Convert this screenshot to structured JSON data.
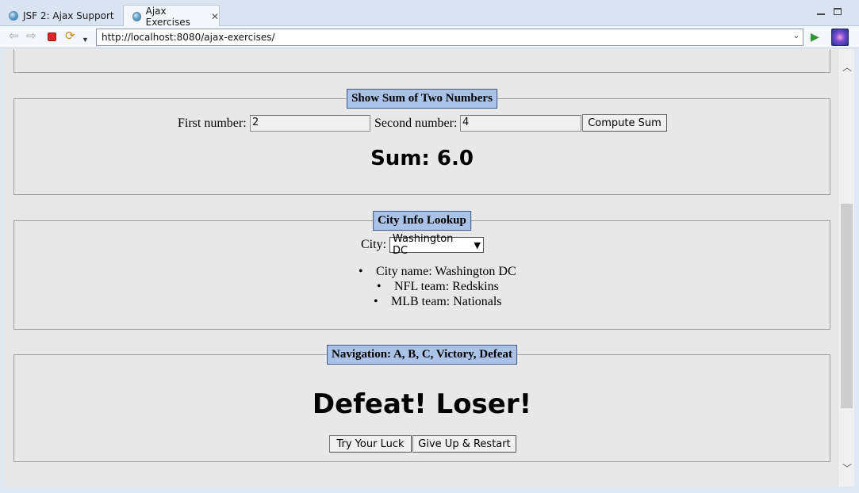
{
  "tabs": [
    {
      "label": "JSF 2: Ajax Support"
    },
    {
      "label": "Ajax Exercises"
    }
  ],
  "toolbar": {
    "url": "http://localhost:8080/ajax-exercises/"
  },
  "sum_section": {
    "legend": "Show Sum of Two Numbers",
    "first_label": "First number:",
    "first_value": "2",
    "second_label": "Second number:",
    "second_value": "4",
    "button_label": "Compute Sum",
    "result": "Sum: 6.0"
  },
  "city_section": {
    "legend": "City Info Lookup",
    "city_label": "City:",
    "selected_city": "Washington DC",
    "items": [
      "City name: Washington DC",
      "NFL team: Redskins",
      "MLB team: Nationals"
    ]
  },
  "nav_section": {
    "legend": "Navigation: A, B, C, Victory, Defeat",
    "heading": "Defeat! Loser!",
    "try_button": "Try Your Luck",
    "restart_button": "Give Up & Restart"
  },
  "icons": {
    "back": "back-arrow-icon",
    "forward": "forward-arrow-icon",
    "stop": "stop-icon",
    "refresh": "refresh-icon",
    "go": "go-icon"
  }
}
